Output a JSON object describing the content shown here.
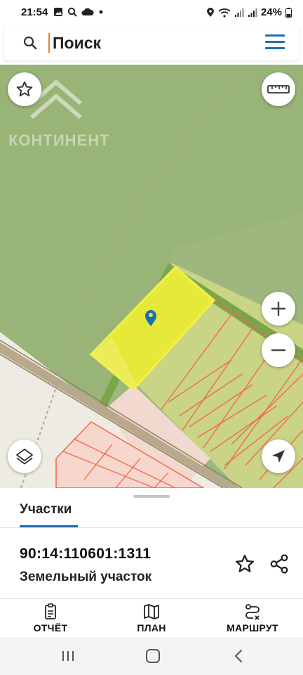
{
  "status_bar": {
    "time": "21:54",
    "battery": "24%",
    "left_icons": [
      "gallery-icon",
      "search-icon",
      "cloud-icon",
      "dot-icon"
    ],
    "right_icons": [
      "location-icon",
      "wifi-icon",
      "signal-icon",
      "signal-icon",
      "battery-icon"
    ]
  },
  "search": {
    "value": "Поиск"
  },
  "map": {
    "watermark": "КОНТИНЕНТ",
    "colors": {
      "forest": "#9db77c",
      "selected_parcel": "#e6e83a",
      "parcel_border": "#f06a4a",
      "road": "#b9a98c"
    }
  },
  "sheet": {
    "tab_label": "Участки",
    "parcel_number": "90:14:110601:1311",
    "parcel_type": "Земельный участок"
  },
  "actions": {
    "report": "ОТЧЁТ",
    "plan": "ПЛАН",
    "route": "МАРШРУТ"
  },
  "accent_color": "#1c6fb5"
}
